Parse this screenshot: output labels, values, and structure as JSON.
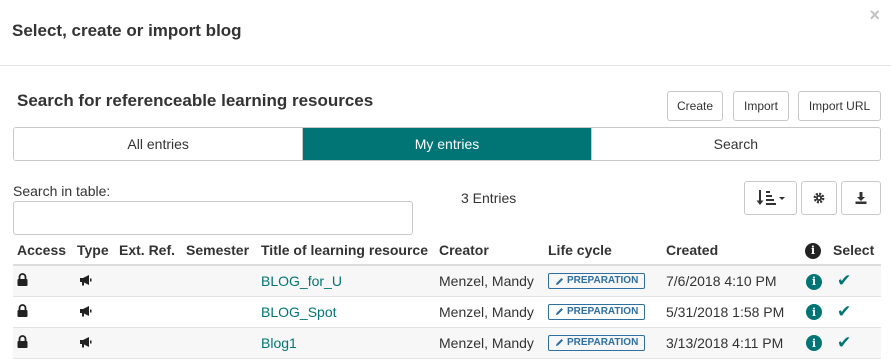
{
  "dialog": {
    "title": "Select, create or import blog",
    "close_icon": "×"
  },
  "section": {
    "title": "Search for referenceable learning resources",
    "actions": {
      "create": "Create",
      "import": "Import",
      "import_url": "Import URL"
    }
  },
  "tabs": {
    "all": "All entries",
    "mine": "My entries",
    "search": "Search",
    "active": "mine"
  },
  "table_search": {
    "label": "Search in table:",
    "value": "",
    "placeholder": ""
  },
  "entries_count": "3 Entries",
  "toolbar": {
    "sort_icon": "sort-amount-icon",
    "settings_icon": "gear-icon",
    "download_icon": "download-icon"
  },
  "table": {
    "headers": {
      "access": "Access",
      "type": "Type",
      "ext_ref": "Ext. Ref.",
      "semester": "Semester",
      "title": "Title of learning resource",
      "creator": "Creator",
      "lifecycle": "Life cycle",
      "created": "Created",
      "info": "i",
      "select": "Select"
    },
    "rows": [
      {
        "ext_ref": "",
        "semester": "",
        "title": "BLOG_for_U",
        "creator": "Menzel, Mandy",
        "lifecycle": "PREPARATION",
        "created": "7/6/2018 4:10 PM",
        "info": "i",
        "select": "✔"
      },
      {
        "ext_ref": "",
        "semester": "",
        "title": "BLOG_Spot",
        "creator": "Menzel, Mandy",
        "lifecycle": "PREPARATION",
        "created": "5/31/2018 1:58 PM",
        "info": "i",
        "select": "✔"
      },
      {
        "ext_ref": "",
        "semester": "",
        "title": "Blog1",
        "creator": "Menzel, Mandy",
        "lifecycle": "PREPARATION",
        "created": "3/13/2018 4:11 PM",
        "info": "i",
        "select": "✔"
      }
    ]
  },
  "colors": {
    "accent": "#017575",
    "badge": "#2f6f9f"
  }
}
